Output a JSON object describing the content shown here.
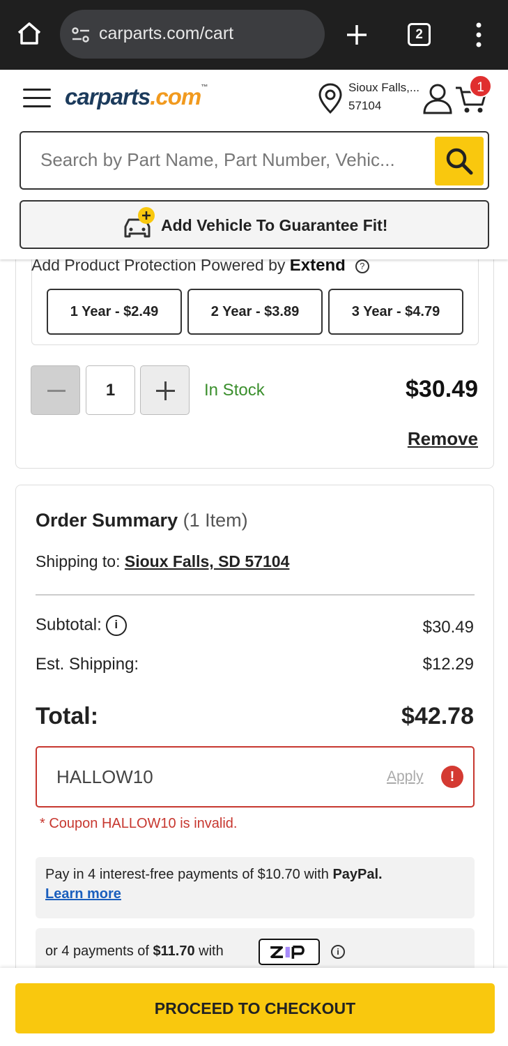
{
  "browser": {
    "url": "carparts.com/cart",
    "tab_count": "2"
  },
  "header": {
    "logo_main": "carparts",
    "logo_com": ".com",
    "logo_tm": "™",
    "location_line1": "Sioux Falls,...",
    "location_line2": "57104",
    "cart_count": "1",
    "search_placeholder": "Search by Part Name, Part Number, Vehic...",
    "add_vehicle_label": "Add Vehicle To Guarantee Fit!"
  },
  "product": {
    "protection_title": "Add Product Protection Powered by",
    "protection_brand": "Extend",
    "plans": [
      "1 Year - $2.49",
      "2 Year - $3.89",
      "3 Year - $4.79"
    ],
    "quantity": "1",
    "stock_status": "In Stock",
    "price": "$30.49",
    "remove_label": "Remove"
  },
  "summary": {
    "title": "Order Summary",
    "item_count": "(1 Item)",
    "shipping_label": "Shipping to:",
    "shipping_location": "Sioux Falls, SD 57104",
    "subtotal_label": "Subtotal:",
    "subtotal_value": "$30.49",
    "shipping_cost_label": "Est. Shipping:",
    "shipping_cost_value": "$12.29",
    "total_label": "Total:",
    "total_value": "$42.78",
    "coupon_value": "HALLOW10",
    "apply_label": "Apply",
    "coupon_error": "* Coupon HALLOW10 is invalid.",
    "paypal_text_pre": "Pay in 4 interest-free payments of $10.70 with ",
    "paypal_brand": "PayPal.",
    "paypal_link": "Learn more",
    "zip_pre": "or 4 payments of ",
    "zip_amount": "$11.70",
    "zip_post": " with"
  },
  "footer": {
    "checkout_label": "PROCEED TO CHECKOUT"
  },
  "colors": {
    "brand_yellow": "#f9c80e",
    "brand_navy": "#1c3b5c",
    "brand_orange": "#f19a1f",
    "error_red": "#c7372f",
    "stock_green": "#3b8f2d"
  }
}
